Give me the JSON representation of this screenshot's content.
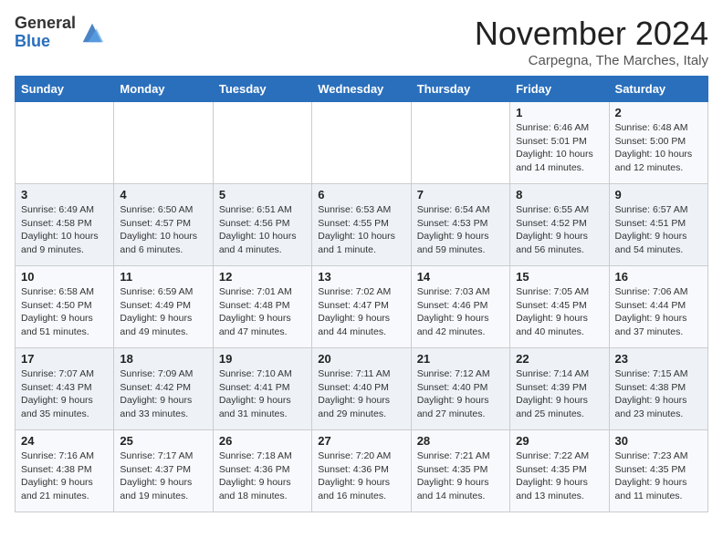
{
  "logo": {
    "general": "General",
    "blue": "Blue"
  },
  "title": "November 2024",
  "subtitle": "Carpegna, The Marches, Italy",
  "headers": [
    "Sunday",
    "Monday",
    "Tuesday",
    "Wednesday",
    "Thursday",
    "Friday",
    "Saturday"
  ],
  "weeks": [
    [
      {
        "day": "",
        "info": ""
      },
      {
        "day": "",
        "info": ""
      },
      {
        "day": "",
        "info": ""
      },
      {
        "day": "",
        "info": ""
      },
      {
        "day": "",
        "info": ""
      },
      {
        "day": "1",
        "info": "Sunrise: 6:46 AM\nSunset: 5:01 PM\nDaylight: 10 hours and 14 minutes."
      },
      {
        "day": "2",
        "info": "Sunrise: 6:48 AM\nSunset: 5:00 PM\nDaylight: 10 hours and 12 minutes."
      }
    ],
    [
      {
        "day": "3",
        "info": "Sunrise: 6:49 AM\nSunset: 4:58 PM\nDaylight: 10 hours and 9 minutes."
      },
      {
        "day": "4",
        "info": "Sunrise: 6:50 AM\nSunset: 4:57 PM\nDaylight: 10 hours and 6 minutes."
      },
      {
        "day": "5",
        "info": "Sunrise: 6:51 AM\nSunset: 4:56 PM\nDaylight: 10 hours and 4 minutes."
      },
      {
        "day": "6",
        "info": "Sunrise: 6:53 AM\nSunset: 4:55 PM\nDaylight: 10 hours and 1 minute."
      },
      {
        "day": "7",
        "info": "Sunrise: 6:54 AM\nSunset: 4:53 PM\nDaylight: 9 hours and 59 minutes."
      },
      {
        "day": "8",
        "info": "Sunrise: 6:55 AM\nSunset: 4:52 PM\nDaylight: 9 hours and 56 minutes."
      },
      {
        "day": "9",
        "info": "Sunrise: 6:57 AM\nSunset: 4:51 PM\nDaylight: 9 hours and 54 minutes."
      }
    ],
    [
      {
        "day": "10",
        "info": "Sunrise: 6:58 AM\nSunset: 4:50 PM\nDaylight: 9 hours and 51 minutes."
      },
      {
        "day": "11",
        "info": "Sunrise: 6:59 AM\nSunset: 4:49 PM\nDaylight: 9 hours and 49 minutes."
      },
      {
        "day": "12",
        "info": "Sunrise: 7:01 AM\nSunset: 4:48 PM\nDaylight: 9 hours and 47 minutes."
      },
      {
        "day": "13",
        "info": "Sunrise: 7:02 AM\nSunset: 4:47 PM\nDaylight: 9 hours and 44 minutes."
      },
      {
        "day": "14",
        "info": "Sunrise: 7:03 AM\nSunset: 4:46 PM\nDaylight: 9 hours and 42 minutes."
      },
      {
        "day": "15",
        "info": "Sunrise: 7:05 AM\nSunset: 4:45 PM\nDaylight: 9 hours and 40 minutes."
      },
      {
        "day": "16",
        "info": "Sunrise: 7:06 AM\nSunset: 4:44 PM\nDaylight: 9 hours and 37 minutes."
      }
    ],
    [
      {
        "day": "17",
        "info": "Sunrise: 7:07 AM\nSunset: 4:43 PM\nDaylight: 9 hours and 35 minutes."
      },
      {
        "day": "18",
        "info": "Sunrise: 7:09 AM\nSunset: 4:42 PM\nDaylight: 9 hours and 33 minutes."
      },
      {
        "day": "19",
        "info": "Sunrise: 7:10 AM\nSunset: 4:41 PM\nDaylight: 9 hours and 31 minutes."
      },
      {
        "day": "20",
        "info": "Sunrise: 7:11 AM\nSunset: 4:40 PM\nDaylight: 9 hours and 29 minutes."
      },
      {
        "day": "21",
        "info": "Sunrise: 7:12 AM\nSunset: 4:40 PM\nDaylight: 9 hours and 27 minutes."
      },
      {
        "day": "22",
        "info": "Sunrise: 7:14 AM\nSunset: 4:39 PM\nDaylight: 9 hours and 25 minutes."
      },
      {
        "day": "23",
        "info": "Sunrise: 7:15 AM\nSunset: 4:38 PM\nDaylight: 9 hours and 23 minutes."
      }
    ],
    [
      {
        "day": "24",
        "info": "Sunrise: 7:16 AM\nSunset: 4:38 PM\nDaylight: 9 hours and 21 minutes."
      },
      {
        "day": "25",
        "info": "Sunrise: 7:17 AM\nSunset: 4:37 PM\nDaylight: 9 hours and 19 minutes."
      },
      {
        "day": "26",
        "info": "Sunrise: 7:18 AM\nSunset: 4:36 PM\nDaylight: 9 hours and 18 minutes."
      },
      {
        "day": "27",
        "info": "Sunrise: 7:20 AM\nSunset: 4:36 PM\nDaylight: 9 hours and 16 minutes."
      },
      {
        "day": "28",
        "info": "Sunrise: 7:21 AM\nSunset: 4:35 PM\nDaylight: 9 hours and 14 minutes."
      },
      {
        "day": "29",
        "info": "Sunrise: 7:22 AM\nSunset: 4:35 PM\nDaylight: 9 hours and 13 minutes."
      },
      {
        "day": "30",
        "info": "Sunrise: 7:23 AM\nSunset: 4:35 PM\nDaylight: 9 hours and 11 minutes."
      }
    ]
  ]
}
